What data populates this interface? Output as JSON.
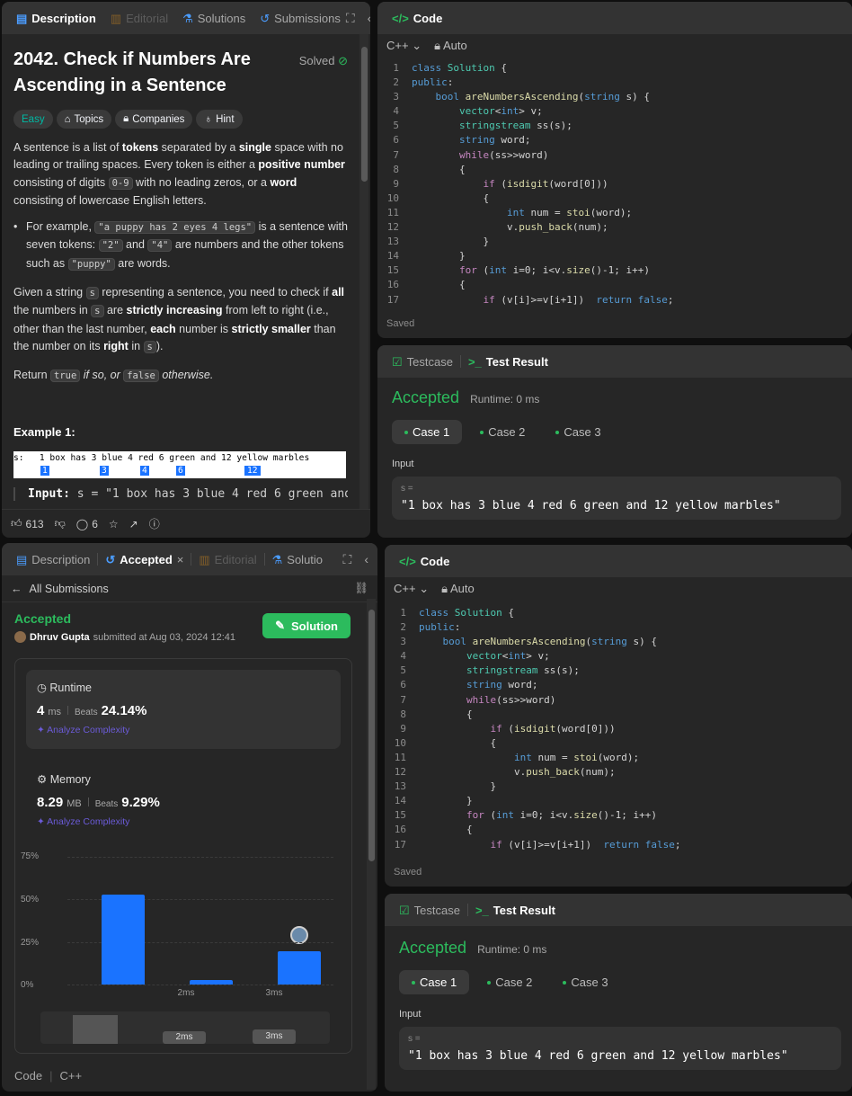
{
  "top_left": {
    "tabs": {
      "description": "Description",
      "editorial": "Editorial",
      "solutions": "Solutions",
      "submissions": "Submissions"
    },
    "title": "2042. Check if Numbers Are Ascending in a Sentence",
    "solved_label": "Solved",
    "chips": {
      "difficulty": "Easy",
      "topics": "Topics",
      "companies": "Companies",
      "hint": "Hint"
    },
    "p1": {
      "a": "A sentence is a list of ",
      "b": "tokens",
      "c": " separated by a ",
      "d": "single",
      "e": " space with no leading or trailing spaces. Every token is either a ",
      "f": "positive number",
      "g": " consisting of digits ",
      "h": "0-9",
      "i": " with no leading zeros, or a ",
      "j": "word",
      "k": " consisting of lowercase English letters."
    },
    "bullet": {
      "a": "For example, ",
      "b": "\"a puppy has 2 eyes 4 legs\"",
      "c": " is a sentence with seven tokens: ",
      "d": "\"2\"",
      "e": " and ",
      "f": "\"4\"",
      "g": " are numbers and the other tokens such as ",
      "h": "\"puppy\"",
      "i": " are words."
    },
    "p2": {
      "a": "Given a string ",
      "b": "s",
      "c": " representing a sentence, you need to check if ",
      "d": "all",
      "e": " the numbers in ",
      "f": "s",
      "g": " are ",
      "h": "strictly increasing",
      "i": " from left to right (i.e., other than the last number, ",
      "j": "each",
      "k": " number is ",
      "l": "strictly smaller",
      "m": " than the number on its ",
      "n": "right",
      "o": " in ",
      "p": "s",
      "q": ")."
    },
    "p3": {
      "a": "Return ",
      "b": "true",
      "c": " if so, or ",
      "d": "false",
      "e": " otherwise."
    },
    "example_title": "Example 1:",
    "example_image_line": "s:   1 box has 3 blue 4 red 6 green and 12 yellow marbles",
    "example_numbers": [
      "1",
      "3",
      "4",
      "6",
      "12"
    ],
    "example_input_label": "Input:",
    "example_input_value": "s = \"1 box has 3 blue 4 red 6 green and",
    "likes": "613",
    "comments": "6"
  },
  "code_label": "Code",
  "language": "C++",
  "auto": "Auto",
  "saved": "Saved",
  "code_lines": [
    "class Solution {",
    "public:",
    "    bool areNumbersAscending(string s) {",
    "        vector<int> v;",
    "        stringstream ss(s);",
    "        string word;",
    "        while(ss>>word)",
    "        {",
    "            if (isdigit(word[0]))",
    "            {",
    "                int num = stoi(word);",
    "                v.push_back(num);",
    "            }",
    "        }",
    "        for (int i=0; i<v.size()-1; i++)",
    "        {",
    "            if (v[i]>=v[i+1])  return false;"
  ],
  "testcase": {
    "testcase_tab": "Testcase",
    "result_tab": "Test Result",
    "status": "Accepted",
    "runtime": "Runtime: 0 ms",
    "cases": [
      "Case 1",
      "Case 2",
      "Case 3"
    ],
    "input_label": "Input",
    "var": "s =",
    "value": "\"1 box has 3 blue 4 red 6 green and 12 yellow marbles\""
  },
  "bottom_left": {
    "tabs": {
      "description": "Description",
      "accepted": "Accepted",
      "editorial": "Editorial",
      "solutions": "Solutio"
    },
    "back": "All Submissions",
    "status": "Accepted",
    "user": "Dhruv Gupta",
    "submitted": "submitted at Aug 03, 2024 12:41",
    "solution_btn": "Solution",
    "runtime_title": "Runtime",
    "runtime_value": "4",
    "runtime_unit": "ms",
    "beats_label": "Beats",
    "runtime_beats": "24.14%",
    "analyze": "Analyze Complexity",
    "memory_title": "Memory",
    "memory_value": "8.29",
    "memory_unit": "MB",
    "memory_beats": "9.29%",
    "footer_code": "Code",
    "footer_lang": "C++",
    "mini_labels": [
      "2ms",
      "3ms"
    ]
  },
  "chart_data": {
    "type": "bar",
    "categories": [
      "",
      "2ms",
      "3ms"
    ],
    "values": [
      53,
      2.5,
      19.5
    ],
    "yticks": [
      "75%",
      "50%",
      "25%",
      "0%"
    ],
    "ylim": [
      0,
      75
    ],
    "highlight_index": 2,
    "bar_color": "#1a73ff",
    "title": "",
    "xlabel": "",
    "ylabel": ""
  },
  "colors": {
    "accent_green": "#2cbb5d",
    "easy": "#00b8a3",
    "orange": "#ffa116",
    "blue": "#1a73ff"
  }
}
